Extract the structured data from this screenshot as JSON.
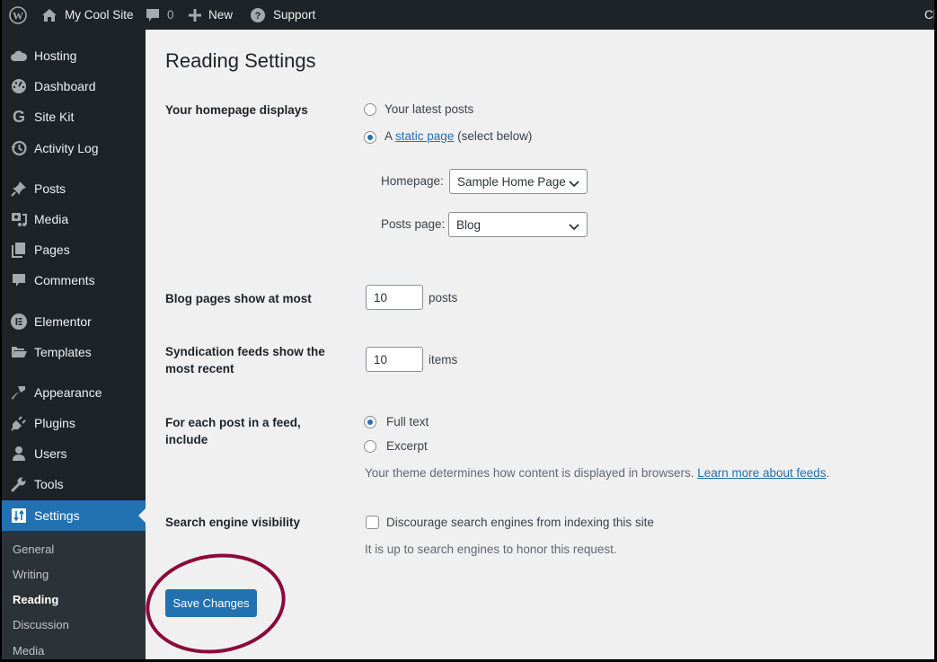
{
  "adminbar": {
    "wp_logo": "wordpress-logo",
    "site_name": "My Cool Site",
    "comments_count": "0",
    "new_label": "New",
    "support_label": "Support",
    "right_truncated": "Cl"
  },
  "sidebar": {
    "items": [
      {
        "label": "Hosting",
        "icon": "cloud-icon"
      },
      {
        "label": "Dashboard",
        "icon": "dashboard-icon"
      },
      {
        "label": "Site Kit",
        "icon": "google-g-icon"
      },
      {
        "label": "Activity Log",
        "icon": "history-icon"
      },
      {
        "label": "Posts",
        "icon": "pushpin-icon"
      },
      {
        "label": "Media",
        "icon": "media-icon"
      },
      {
        "label": "Pages",
        "icon": "pages-icon"
      },
      {
        "label": "Comments",
        "icon": "comment-icon"
      },
      {
        "label": "Elementor",
        "icon": "elementor-icon"
      },
      {
        "label": "Templates",
        "icon": "folder-icon"
      },
      {
        "label": "Appearance",
        "icon": "paintbrush-icon"
      },
      {
        "label": "Plugins",
        "icon": "plug-icon"
      },
      {
        "label": "Users",
        "icon": "user-icon"
      },
      {
        "label": "Tools",
        "icon": "wrench-icon"
      },
      {
        "label": "Settings",
        "icon": "settings-icon",
        "active": true
      }
    ],
    "submenu": [
      {
        "label": "General"
      },
      {
        "label": "Writing"
      },
      {
        "label": "Reading",
        "current": true
      },
      {
        "label": "Discussion"
      },
      {
        "label": "Media"
      }
    ]
  },
  "main": {
    "title": "Reading Settings",
    "homepage_displays": {
      "label": "Your homepage displays",
      "option_latest": "Your latest posts",
      "option_static_prefix": "A",
      "option_static_link": "static page",
      "option_static_suffix": "(select below)",
      "selected": "static",
      "homepage_label": "Homepage:",
      "homepage_value": "Sample Home Page",
      "posts_page_label": "Posts page:",
      "posts_page_value": "Blog"
    },
    "blog_pages": {
      "label": "Blog pages show at most",
      "value": "10",
      "unit": "posts"
    },
    "syndication": {
      "label": "Syndication feeds show the most recent",
      "value": "10",
      "unit": "items"
    },
    "feed_include": {
      "label": "For each post in a feed, include",
      "option_full": "Full text",
      "option_excerpt": "Excerpt",
      "selected": "full",
      "description": "Your theme determines how content is displayed in browsers.",
      "link": "Learn more about feeds",
      "link_suffix": "."
    },
    "search_visibility": {
      "label": "Search engine visibility",
      "checkbox_label": "Discourage search engines from indexing this site",
      "checked": false,
      "description": "It is up to search engines to honor this request."
    },
    "save_label": "Save Changes"
  },
  "colors": {
    "accent": "#2271b1",
    "adminbar_bg": "#1d2327",
    "highlight_ring": "#8b0a3a"
  }
}
